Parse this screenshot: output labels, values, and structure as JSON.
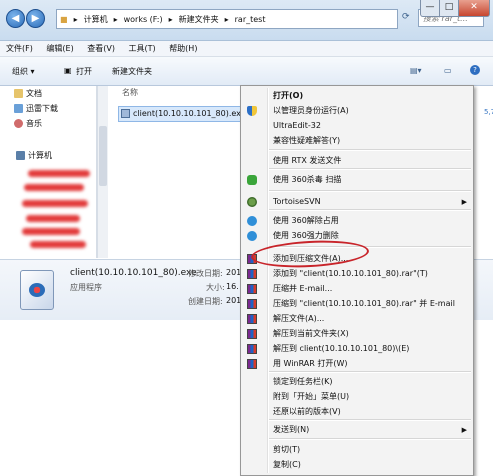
{
  "window": {
    "address": {
      "parts": [
        "计算机",
        "works (F:)",
        "新建文件夹",
        "rar_test"
      ],
      "separators": [
        "▸",
        "▸",
        "▸",
        "▸"
      ]
    },
    "search_placeholder": "搜索 rar_t...",
    "controls": {
      "minimize": "—",
      "maximize": "□",
      "close": "✕"
    }
  },
  "menubar": [
    "文件(F)",
    "编辑(E)",
    "查看(V)",
    "工具(T)",
    "帮助(H)"
  ],
  "toolbar": {
    "organize": "组织 ▾",
    "open": "打开",
    "new_folder": "新建文件夹"
  },
  "navpane": {
    "items": [
      "文档",
      "迅雷下载",
      "音乐"
    ],
    "computer": "计算机"
  },
  "filelist": {
    "column_name": "名称",
    "file": "client(10.10.10.101_80).exe"
  },
  "details": {
    "filename": "client(10.10.10.101_80).exe",
    "type": "应用程序",
    "modified_label": "修改日期:",
    "modified_value": "201",
    "size_label": "大小:",
    "size_value": "16.",
    "created_label": "创建日期:",
    "created_value": "201"
  },
  "context_menu": {
    "items": [
      {
        "label": "打开(O)",
        "bold": true,
        "icon": "none"
      },
      {
        "label": "以管理员身份运行(A)",
        "icon": "shield-icon"
      },
      {
        "label": "UltraEdit-32",
        "icon": "none"
      },
      {
        "label": "兼容性疑难解答(Y)",
        "icon": "none"
      },
      {
        "label": "使用 RTX 发送文件",
        "icon": "none"
      },
      {
        "label": "使用 360杀毒 扫描",
        "icon": "360-antivirus-icon"
      },
      {
        "label": "TortoiseSVN",
        "icon": "tortoise-icon",
        "submenu": true
      },
      {
        "label": "使用 360解除占用",
        "icon": "360-icon"
      },
      {
        "label": "使用 360强力删除",
        "icon": "360-icon"
      },
      {
        "label": "添加到压缩文件(A)...",
        "icon": "winrar-icon"
      },
      {
        "label": "添加到 \"client(10.10.10.101_80).rar\"(T)",
        "icon": "winrar-icon"
      },
      {
        "label": "压缩并 E-mail...",
        "icon": "winrar-icon"
      },
      {
        "label": "压缩到 \"client(10.10.10.101_80).rar\" 并 E-mail",
        "icon": "winrar-icon"
      },
      {
        "label": "解压文件(A)...",
        "icon": "winrar-icon"
      },
      {
        "label": "解压到当前文件夹(X)",
        "icon": "winrar-icon"
      },
      {
        "label": "解压到 client(10.10.10.101_80)\\(E)",
        "icon": "winrar-icon"
      },
      {
        "label": "用 WinRAR 打开(W)",
        "icon": "winrar-icon"
      },
      {
        "label": "锁定到任务栏(K)",
        "icon": "none"
      },
      {
        "label": "附到「开始」菜单(U)",
        "icon": "none"
      },
      {
        "label": "还原以前的版本(V)",
        "icon": "none"
      },
      {
        "label": "发送到(N)",
        "icon": "none",
        "submenu": true
      },
      {
        "label": "剪切(T)",
        "icon": "none"
      },
      {
        "label": "复制(C)",
        "icon": "none"
      }
    ],
    "submenu_arrow": "▶"
  },
  "colors": {
    "highlight_circle": "#c8242a",
    "selection": "#d7e8fb"
  }
}
